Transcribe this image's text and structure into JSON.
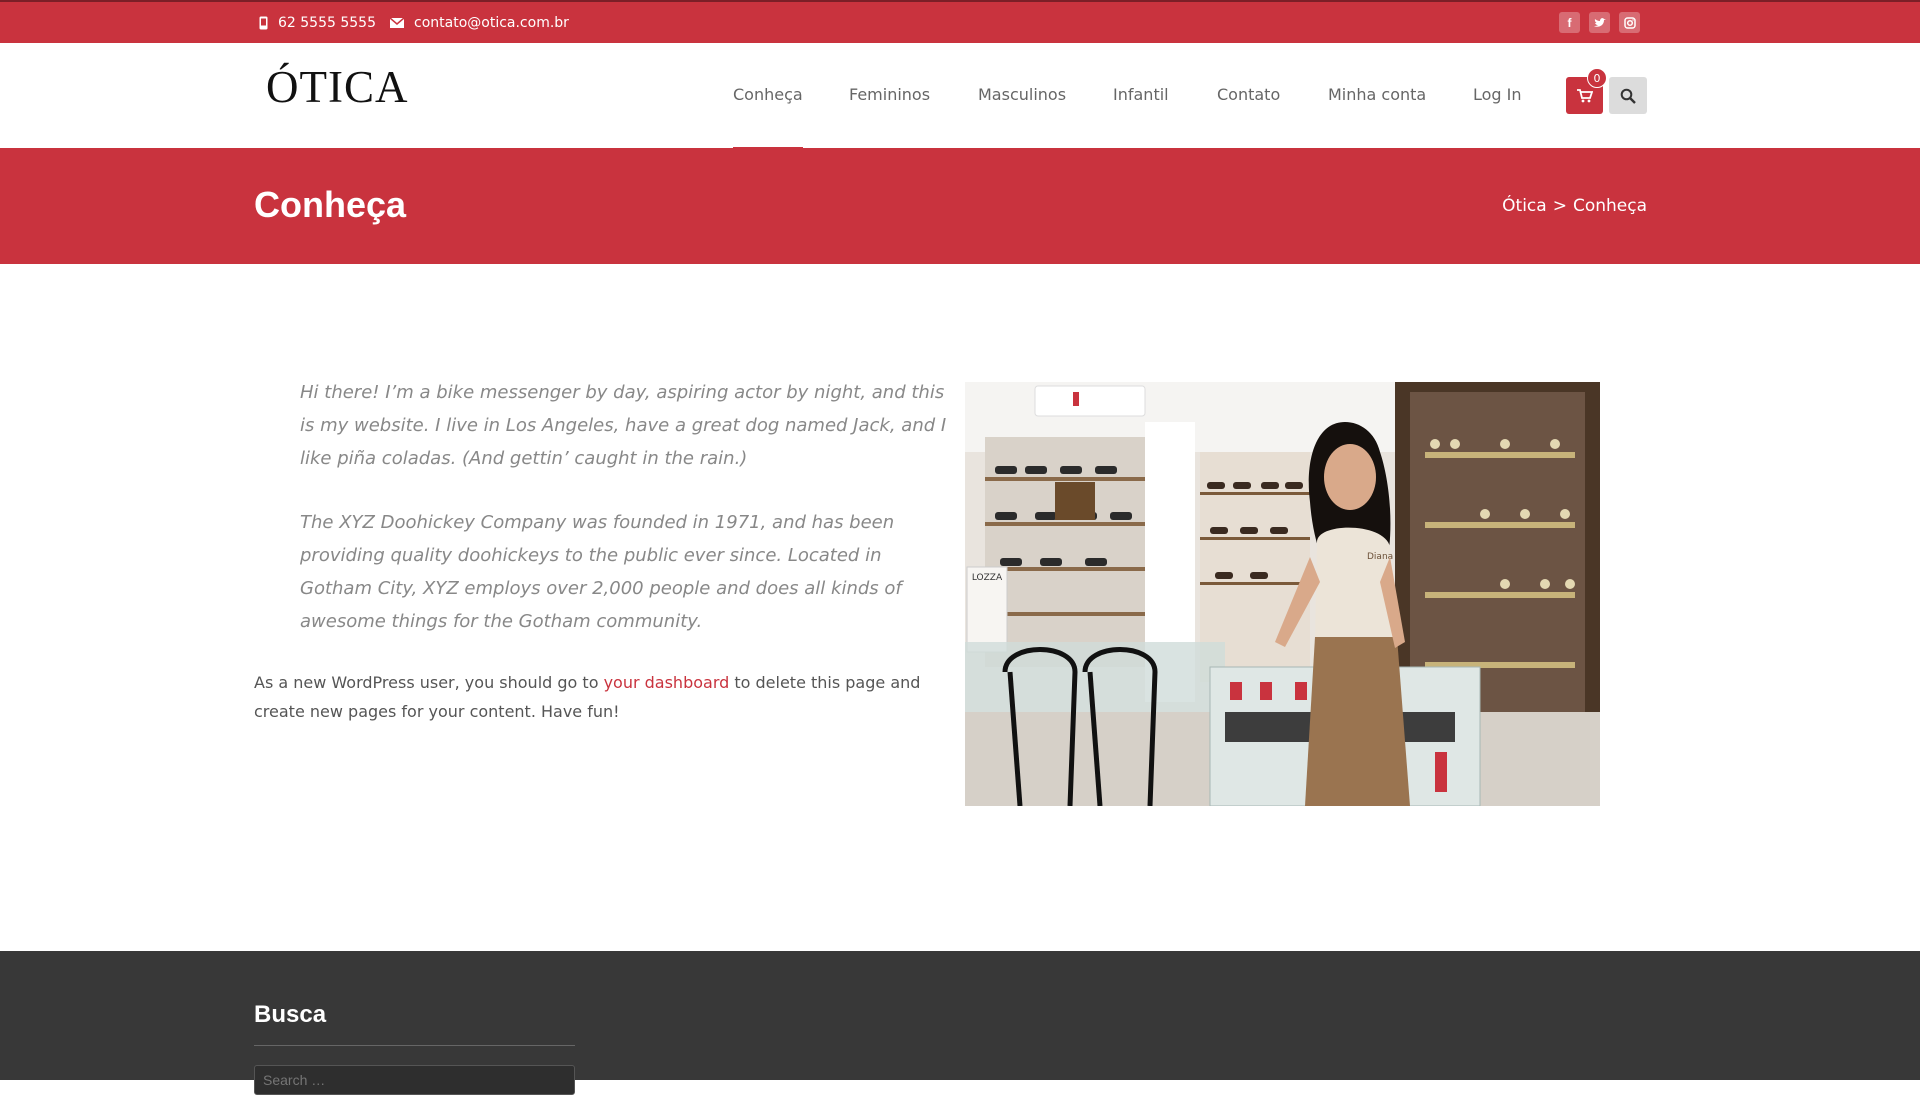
{
  "topbar": {
    "phone": "62 5555 5555",
    "email": "contato@otica.com.br",
    "social": [
      "facebook-icon",
      "twitter-icon",
      "instagram-icon"
    ]
  },
  "header": {
    "logo": "ÓTICA",
    "nav": [
      {
        "label": "Conheça",
        "active": true
      },
      {
        "label": "Femininos",
        "active": false
      },
      {
        "label": "Masculinos",
        "active": false
      },
      {
        "label": "Infantil",
        "active": false
      },
      {
        "label": "Contato",
        "active": false
      },
      {
        "label": "Minha conta",
        "active": false
      },
      {
        "label": "Log In",
        "active": false
      }
    ],
    "cart_count": "0"
  },
  "banner": {
    "title": "Conheça",
    "breadcrumb": {
      "home": "Ótica",
      "separator": ">",
      "current": "Conheça"
    }
  },
  "content": {
    "quote1": "Hi there! I’m a bike messenger by day, aspiring actor by night, and this is my website. I live in Los Angeles, have a great dog named Jack, and I like piña coladas. (And gettin’ caught in the rain.)",
    "quote2": "The XYZ Doohickey Company was founded in 1971, and has been providing quality doohickeys to the public ever since. Located in Gotham City, XYZ employs over 2,000 people and does all kinds of awesome things for the Gotham community.",
    "body_before": "As a new WordPress user, you should go to ",
    "body_link": "your dashboard",
    "body_after": " to delete this page and create new pages for your content. Have fun!",
    "photo_sign": "LOZZA",
    "photo_shirt": "Diana"
  },
  "footer": {
    "widget_title": "Busca",
    "search_placeholder": "Search …"
  },
  "colors": {
    "accent": "#c9333e",
    "footer_bg": "#383838"
  }
}
